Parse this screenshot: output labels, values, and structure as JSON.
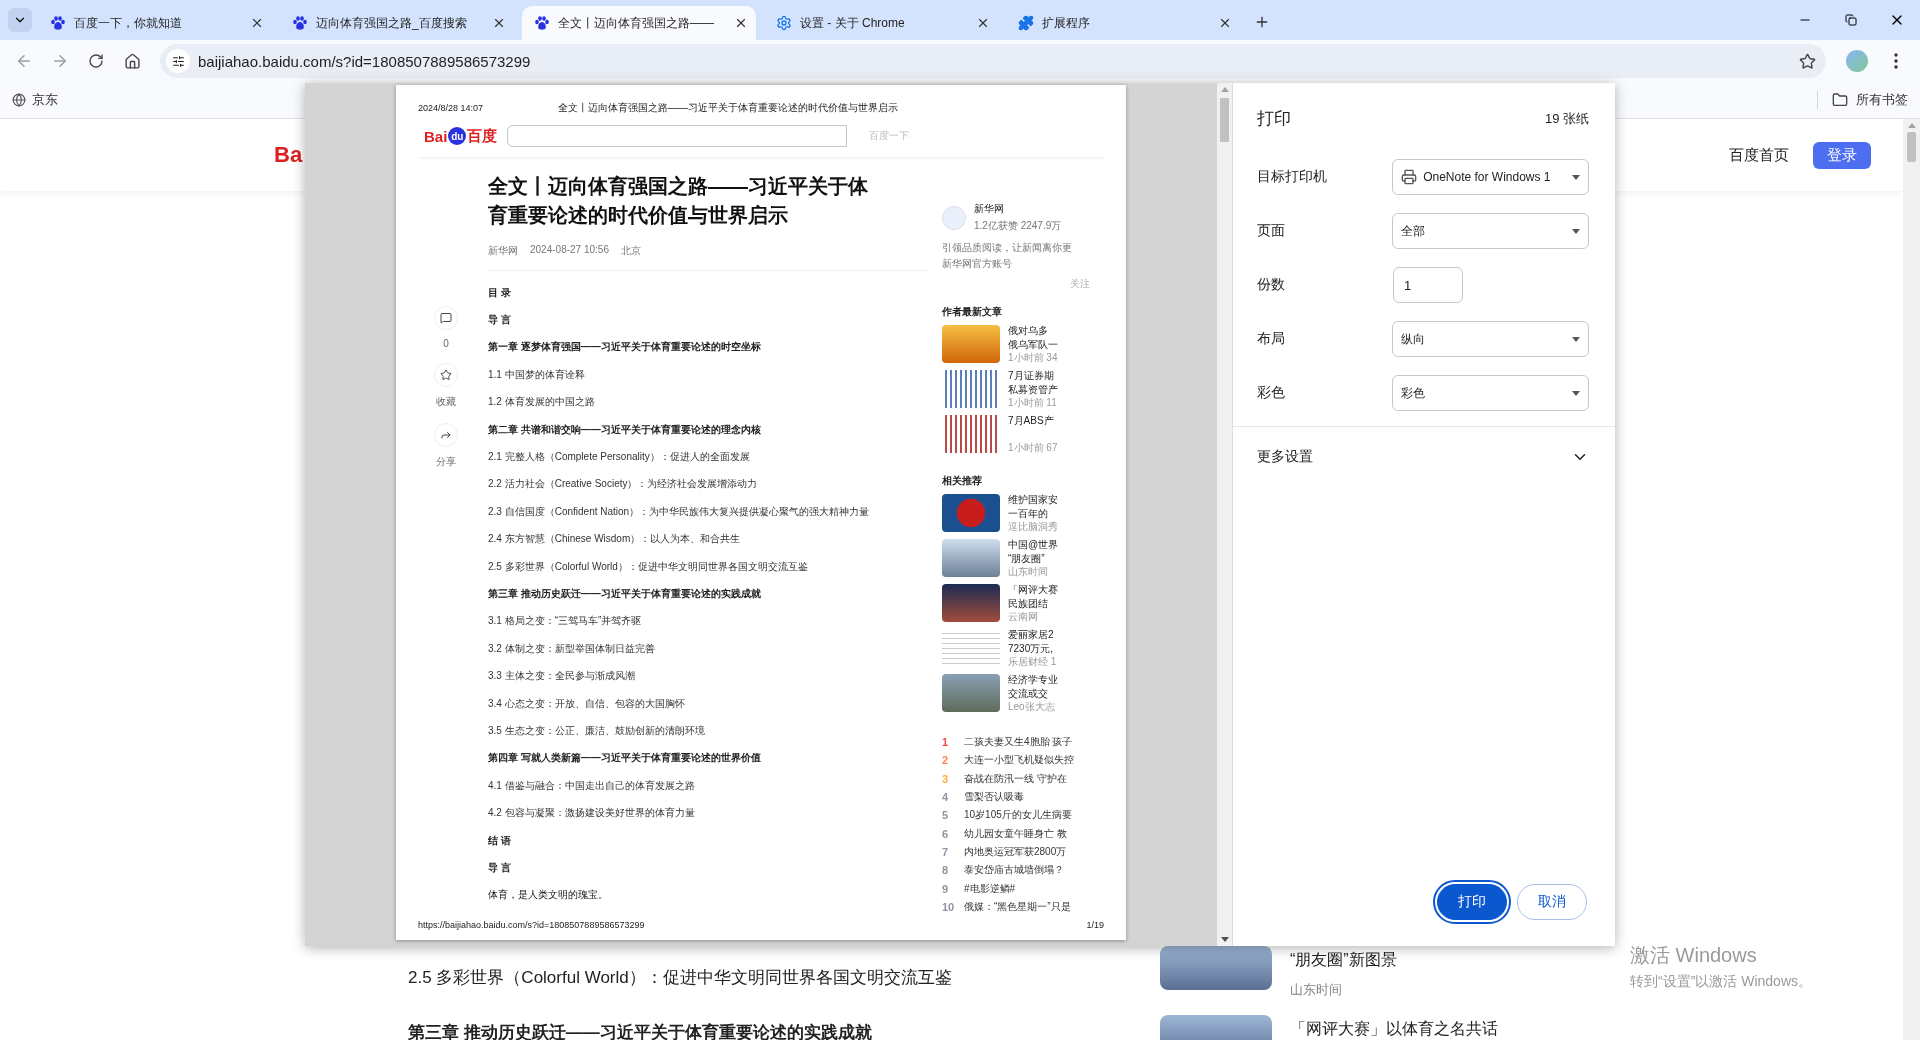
{
  "browser": {
    "tabs": [
      {
        "title": "百度一下，你就知道",
        "selected": false
      },
      {
        "title": "迈向体育强国之路_百度搜索",
        "selected": false
      },
      {
        "title": "全文丨迈向体育强国之路——",
        "selected": true
      },
      {
        "title": "设置 - 关于 Chrome",
        "selected": false
      },
      {
        "title": "扩展程序",
        "selected": false
      }
    ],
    "url": "baijiahao.baidu.com/s?id=1808507889586573299",
    "bookmarks": [
      {
        "label": "京东"
      }
    ],
    "all_bookmarks": "所有书签"
  },
  "page": {
    "logo_fragment": "Ba",
    "nav_link": "百度首页",
    "login": "登录",
    "lines": [
      {
        "text": "2.5 多彩世界（Colorful World）：促进中华文明同世界各国文明交流互鉴",
        "kind": "item"
      },
      {
        "text": "第三章 推动历史跃迁——习近平关于体育重要论述的实践成就",
        "kind": "heading"
      }
    ],
    "related": [
      {
        "title": "“朋友圈”新图景",
        "source": "山东时间"
      },
      {
        "title": "「网评大赛」以体育之名共话"
      }
    ]
  },
  "print_preview": {
    "header_date": "2024/8/28 14:07",
    "header_title": "全文丨迈向体育强国之路——习近平关于体育重要论述的时代价值与世界启示",
    "logo": {
      "left": "Bai",
      "paw": "du",
      "right": "百度"
    },
    "search_button": "百度一下",
    "title": "全文丨迈向体育强国之路——习近平关于体育重要论述的时代价值与世界启示",
    "meta": {
      "source": "新华网",
      "time": "2024-08-27 10:56",
      "place": "北京"
    },
    "actions": [
      {
        "label": "0"
      },
      {
        "label": "收藏"
      },
      {
        "label": "分享"
      }
    ],
    "toc": [
      {
        "text": "目 录",
        "kind": "heading"
      },
      {
        "text": "导 言",
        "kind": "heading"
      },
      {
        "text": "第一章 逐梦体育强国——习近平关于体育重要论述的时空坐标",
        "kind": "heading"
      },
      {
        "text": "1.1 中国梦的体育诠释",
        "kind": "item"
      },
      {
        "text": "1.2 体育发展的中国之路",
        "kind": "item"
      },
      {
        "text": "第二章 共谱和谐交响——习近平关于体育重要论述的理念内核",
        "kind": "heading"
      },
      {
        "text": "2.1 完整人格（Complete Personality）：促进人的全面发展",
        "kind": "item"
      },
      {
        "text": "2.2 活力社会（Creative Society）：为经济社会发展增添动力",
        "kind": "item"
      },
      {
        "text": "2.3 自信国度（Confident Nation）：为中华民族伟大复兴提供凝心聚气的强大精神力量",
        "kind": "item"
      },
      {
        "text": "2.4 东方智慧（Chinese Wisdom）：以人为本、和合共生",
        "kind": "item"
      },
      {
        "text": "2.5 多彩世界（Colorful World）：促进中华文明同世界各国文明交流互鉴",
        "kind": "item"
      },
      {
        "text": "第三章 推动历史跃迁——习近平关于体育重要论述的实践成就",
        "kind": "heading"
      },
      {
        "text": "3.1 格局之变：“三驾马车”并驾齐驱",
        "kind": "item"
      },
      {
        "text": "3.2 体制之变：新型举国体制日益完善",
        "kind": "item"
      },
      {
        "text": "3.3 主体之变：全民参与渐成风潮",
        "kind": "item"
      },
      {
        "text": "3.4 心态之变：开放、自信、包容的大国胸怀",
        "kind": "item"
      },
      {
        "text": "3.5 生态之变：公正、廉洁、鼓励创新的清朗环境",
        "kind": "item"
      },
      {
        "text": "第四章 写就人类新篇——习近平关于体育重要论述的世界价值",
        "kind": "heading"
      },
      {
        "text": "4.1 借鉴与融合：中国走出自己的体育发展之路",
        "kind": "item"
      },
      {
        "text": "4.2 包容与凝聚：激扬建设美好世界的体育力量",
        "kind": "item"
      },
      {
        "text": "结 语",
        "kind": "heading"
      },
      {
        "text": "导 言",
        "kind": "heading"
      },
      {
        "text": "体育，是人类文明的瑰宝。",
        "kind": "body"
      }
    ],
    "author": {
      "name": "新华网",
      "stats": "1.2亿获赞 2247.9万",
      "bio": "引领品质阅读，让新闻离你更",
      "account": "新华网官方账号",
      "follow": "关注"
    },
    "latest_title": "作者最新文章",
    "latest": [
      {
        "lines": [
          "俄对乌多",
          "俄乌军队一"
        ],
        "meta": "1小时前 34"
      },
      {
        "lines": [
          "7月证券期",
          "私募资管产"
        ],
        "meta": "1小时前 11"
      },
      {
        "lines": [
          "7月ABS产"
        ],
        "meta": "1小时前 67"
      }
    ],
    "related_title": "相关推荐",
    "related": [
      {
        "lines": [
          "维护国家安",
          "一百年的"
        ],
        "meta": "逗比脑洞秀"
      },
      {
        "lines": [
          "中国@世界",
          "“朋友圈”"
        ],
        "meta": "山东时间"
      },
      {
        "lines": [
          "「网评大赛",
          "民族团结"
        ],
        "meta": "云南网"
      },
      {
        "lines": [
          "爱丽家居2",
          "7230万元,"
        ],
        "meta": "乐居财经 1"
      },
      {
        "lines": [
          "经济学专业",
          "交流或交"
        ],
        "meta": "Leo张大志"
      }
    ],
    "hot": [
      {
        "rank": "1",
        "text": "二孩夫妻又生4胞胎 孩子",
        "color": "#f54545"
      },
      {
        "rank": "2",
        "text": "大连一小型飞机疑似失控",
        "color": "#ff8547"
      },
      {
        "rank": "3",
        "text": "奋战在防汛一线 守护在",
        "color": "#ffac38"
      },
      {
        "rank": "4",
        "text": "雪梨否认吸毒",
        "color": "#9195a3"
      },
      {
        "rank": "5",
        "text": "10岁105斤的女儿生病要",
        "color": "#9195a3"
      },
      {
        "rank": "6",
        "text": "幼儿园女童午睡身亡 教",
        "color": "#9195a3"
      },
      {
        "rank": "7",
        "text": "内地奥运冠军获2800万",
        "color": "#9195a3"
      },
      {
        "rank": "8",
        "text": "泰安岱庙古城墙倒塌？",
        "color": "#9195a3"
      },
      {
        "rank": "9",
        "text": "#电影逆鳞#",
        "color": "#9195a3"
      },
      {
        "rank": "10",
        "text": "俄媒：“黑色星期一”只是",
        "color": "#9195a3"
      }
    ],
    "footer_url": "https://baijiahao.baidu.com/s?id=1808507889586573299",
    "page_number": "1/19"
  },
  "print_dialog": {
    "title": "打印",
    "sheets": "19 张纸",
    "settings": [
      {
        "label": "目标打印机",
        "kind": "select",
        "value": "OneNote for Windows 1"
      },
      {
        "label": "页面",
        "kind": "select",
        "value": "全部"
      },
      {
        "label": "份数",
        "kind": "input",
        "value": "1"
      },
      {
        "label": "布局",
        "kind": "select",
        "value": "纵向"
      },
      {
        "label": "彩色",
        "kind": "select",
        "value": "彩色"
      }
    ],
    "more": {
      "label": "更多设置",
      "expanded": false
    },
    "buttons": [
      {
        "label": "打印",
        "kind": "primary"
      },
      {
        "label": "取消",
        "kind": "secondary"
      }
    ]
  },
  "os_notice": {
    "title": "激活 Windows",
    "text": "转到“设置”以激活 Windows。"
  }
}
